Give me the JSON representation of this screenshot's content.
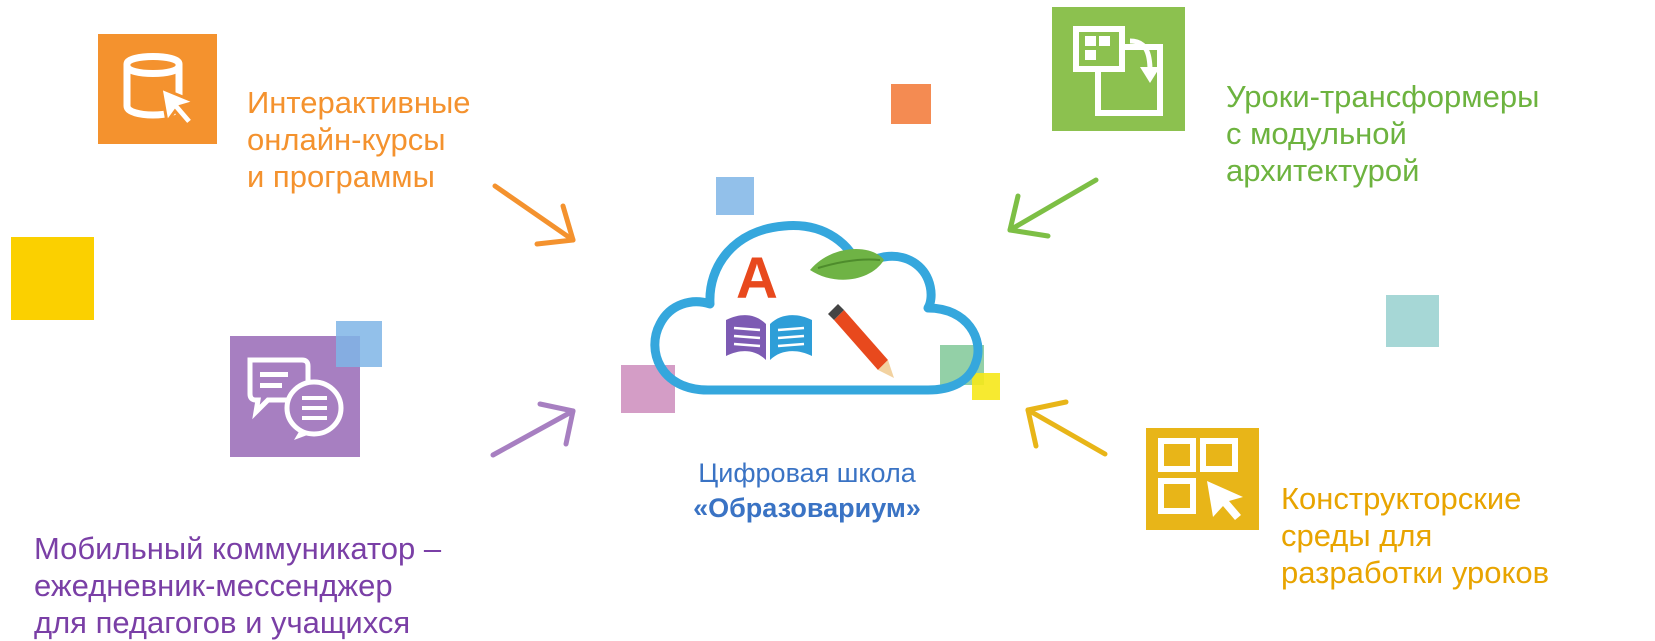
{
  "colors": {
    "orange": "#f4922e",
    "green": "#7dbf45",
    "purple": "#7a3fa6",
    "yellow": "#e8b518",
    "blue": "#3a73c4",
    "cloud": "#35a7dd"
  },
  "features": {
    "courses": {
      "icon": "cylinder-cursor-icon",
      "lines": [
        "Интерактивные",
        "онлайн-курсы",
        "и программы"
      ]
    },
    "lessons": {
      "icon": "module-transform-icon",
      "lines": [
        "Уроки-трансформеры",
        "с модульной",
        "архитектурой"
      ]
    },
    "communicator": {
      "icon": "chat-bubbles-icon",
      "lines": [
        "Мобильный коммуникатор –",
        "ежедневник-мессенджер",
        "для педагогов и учащихся"
      ]
    },
    "constructor": {
      "icon": "grid-cursor-icon",
      "lines": [
        "Конструкторские",
        "среды для",
        "разработки уроков"
      ]
    }
  },
  "center": {
    "icon": "cloud-icon",
    "title_line1": "Цифровая школа",
    "title_line2": "«Образовариум»",
    "cloud_letter": "А"
  }
}
